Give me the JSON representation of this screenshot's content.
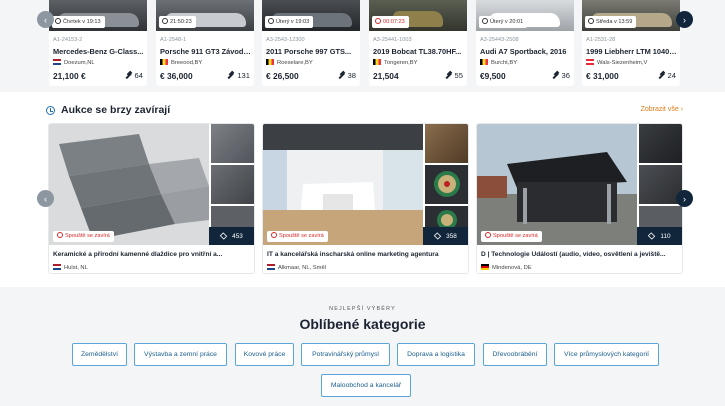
{
  "top_lots": [
    {
      "time": "Čtvrtek v 19:13",
      "time_red": false,
      "id": "A1-24153-2",
      "title": "Mercedes-Benz G-Class...",
      "flag": "nl",
      "location": "Doezum,NL",
      "price": "21,100 €",
      "bids": "64"
    },
    {
      "time": "21:50:23",
      "time_red": false,
      "id": "A1-2548-1",
      "title": "Porsche 911 GT3 Závodní...",
      "flag": "be",
      "location": "Breeood,BY",
      "price": "€ 36,000",
      "bids": "131"
    },
    {
      "time": "Úterý v 19:03",
      "time_red": false,
      "id": "A3-2543-12300",
      "title": "2011 Porsche 997 GTS...",
      "flag": "be",
      "location": "Roeselare,BY",
      "price": "€ 26,500",
      "bids": "38"
    },
    {
      "time": "00:07:23",
      "time_red": true,
      "id": "A3-25441-1003",
      "title": "2019 Bobcat TL38.70HF...",
      "flag": "be",
      "location": "Tongeren,BY",
      "price": "21,504",
      "bids": "55"
    },
    {
      "time": "Úterý v 20:01",
      "time_red": false,
      "id": "A3-25443-2508",
      "title": "Audi A7 Sportback, 2016",
      "flag": "be",
      "location": "Burcht,BY",
      "price": "€9,500",
      "bids": "36"
    },
    {
      "time": "Středa v 13:59",
      "time_red": false,
      "id": "A1-2531-28",
      "title": "1999 Liebherr LTM 1040/1...",
      "flag": "at",
      "location": "Wals-Siezenheim,V",
      "price": "€ 31,000",
      "bids": "24"
    }
  ],
  "closing_section": {
    "title": "Aukce se brzy zavírají",
    "see_all": "Zobrazit vše ›",
    "auctions": [
      {
        "badge": "Spouště se zavírá",
        "count": "453",
        "title": "Keramické a přírodní kamenné dlaždice pro vnitřní a...",
        "flag": "nl",
        "location": "Hulst, NL"
      },
      {
        "badge": "Spouště se zavírá",
        "count": "358",
        "title": "IT a kancelářská inscharská online marketing agentura",
        "flag": "nl",
        "location": "Alkmaar, NL, Směl"
      },
      {
        "badge": "Spouště se zavírá",
        "count": "110",
        "title": "D | Technologie Událostí (audio, video, osvětlení a jeviště...",
        "flag": "de",
        "location": "Mindenová, DE"
      }
    ]
  },
  "categories": {
    "eyebrow": "NEJLEPŠÍ VÝBĚRY",
    "title": "Oblíbené kategorie",
    "items": [
      "Zemědělství",
      "Výstavba a zemní práce",
      "Kovové práce",
      "Potravinářský průmysl",
      "Doprava a logistika",
      "Dřevoobrábění",
      "Více průmyslových kategorií",
      "Maloobchod a kancelář"
    ]
  },
  "icons": {
    "prev": "chevron-left-icon",
    "next": "chevron-right-icon",
    "clock": "clock-icon",
    "bids": "gavel-icon",
    "photos": "layers-icon"
  },
  "colors": {
    "accent": "#e07a16",
    "closing_red": "#d72828",
    "navy": "#11263b",
    "chip_border": "#5aa6d8"
  }
}
